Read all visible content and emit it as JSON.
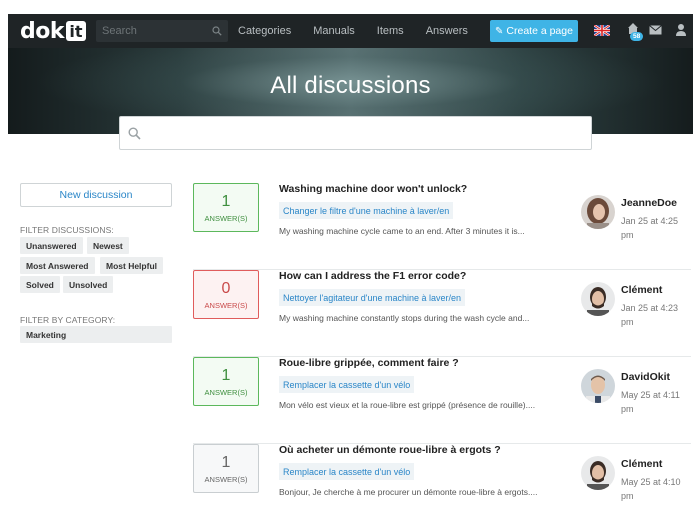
{
  "header": {
    "logo_text": "dok",
    "logo_box_text": "it",
    "search_placeholder": "Search",
    "nav": [
      "Categories",
      "Manuals",
      "Items",
      "Answers"
    ],
    "create_button": "Create a page",
    "notifications_count": "58",
    "icons": [
      "search-icon",
      "pencil-icon",
      "uk-flag-icon",
      "notifications-icon",
      "mail-icon",
      "user-icon"
    ]
  },
  "hero": {
    "title": "All discussions",
    "search_placeholder": ""
  },
  "sidebar": {
    "new_discussion": "New discussion",
    "filter_label": "FILTER DISCUSSIONS:",
    "filters": [
      "Unanswered",
      "Newest",
      "Most Answered",
      "Most Helpful",
      "Solved",
      "Unsolved"
    ],
    "category_label": "FILTER BY CATEGORY:",
    "categories": [
      "Marketing"
    ]
  },
  "discussions": [
    {
      "count": "1",
      "count_label": "ANSWER(S)",
      "status": "answered",
      "title": "Washing machine door won't unlock?",
      "guide": "Changer le filtre d'une machine à laver/en",
      "excerpt": "My washing machine cycle came to an end. After 3 minutes it is...",
      "author": "JeanneDoe",
      "date": "Jan 25 at 4:25 pm"
    },
    {
      "count": "0",
      "count_label": "ANSWER(S)",
      "status": "unanswered",
      "title": "How can I address the F1 error code?",
      "guide": "Nettoyer l'agitateur d'une machine à laver/en",
      "excerpt": "My washing machine constantly stops during the wash cycle and...",
      "author": "Clément",
      "date": "Jan 25 at 4:23 pm"
    },
    {
      "count": "1",
      "count_label": "ANSWER(S)",
      "status": "answered",
      "title": "Roue-libre grippée, comment faire ?",
      "guide": "Remplacer la cassette d'un vélo",
      "excerpt": "Mon vélo est vieux et la roue-libre est grippé (présence de rouille)....",
      "author": "DavidOkit",
      "date": "May 25 at 4:11 pm"
    },
    {
      "count": "1",
      "count_label": "ANSWER(S)",
      "status": "neutral",
      "title": "Où acheter un démonte roue-libre à ergots ?",
      "guide": "Remplacer la cassette d'un vélo",
      "excerpt": "Bonjour, Je cherche à me procurer un démonte roue-libre à ergots....",
      "author": "Clément",
      "date": "May 25 at 4:10 pm"
    }
  ],
  "colors": {
    "topbar": "#1f2426",
    "accent": "#3fb4e6",
    "answered": "#5cb85c",
    "unanswered": "#e05c5c",
    "link": "#2a86c8"
  }
}
